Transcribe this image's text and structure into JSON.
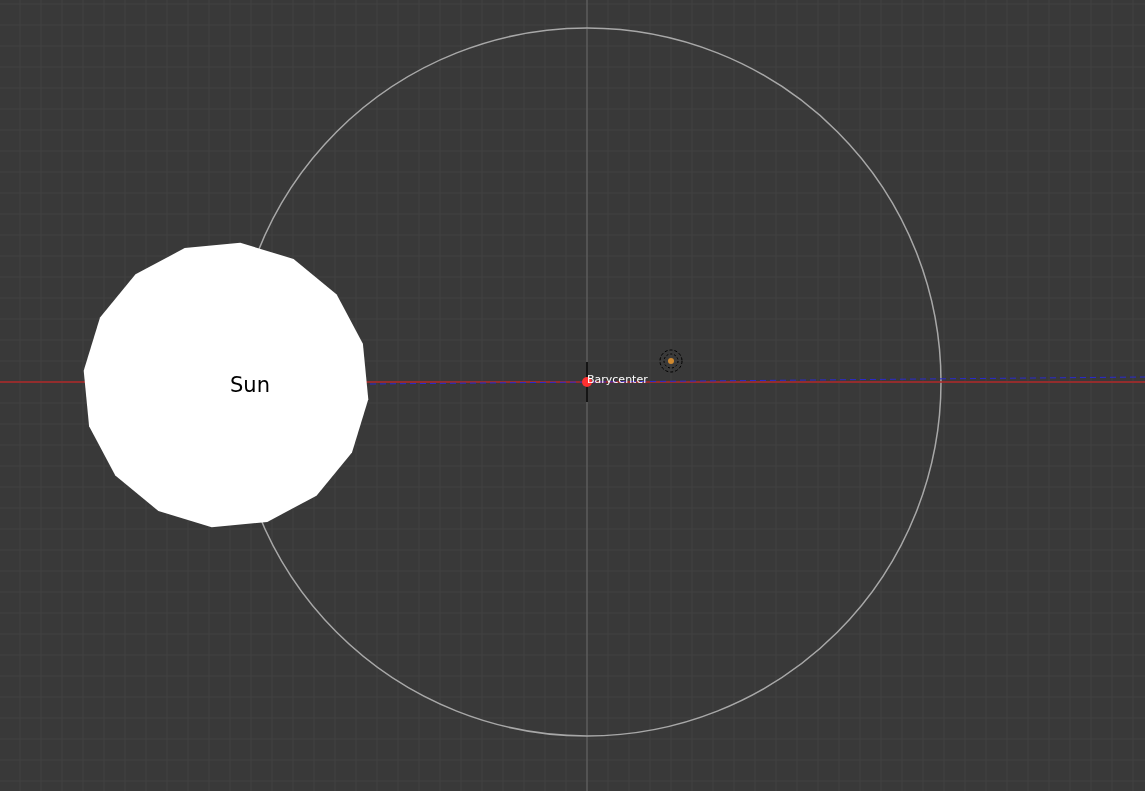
{
  "viewport": {
    "objects": [
      {
        "kind": "sphere",
        "label": "Sun"
      },
      {
        "kind": "empty",
        "label": "Barycenter",
        "selected": true
      },
      {
        "kind": "lamp"
      }
    ]
  }
}
